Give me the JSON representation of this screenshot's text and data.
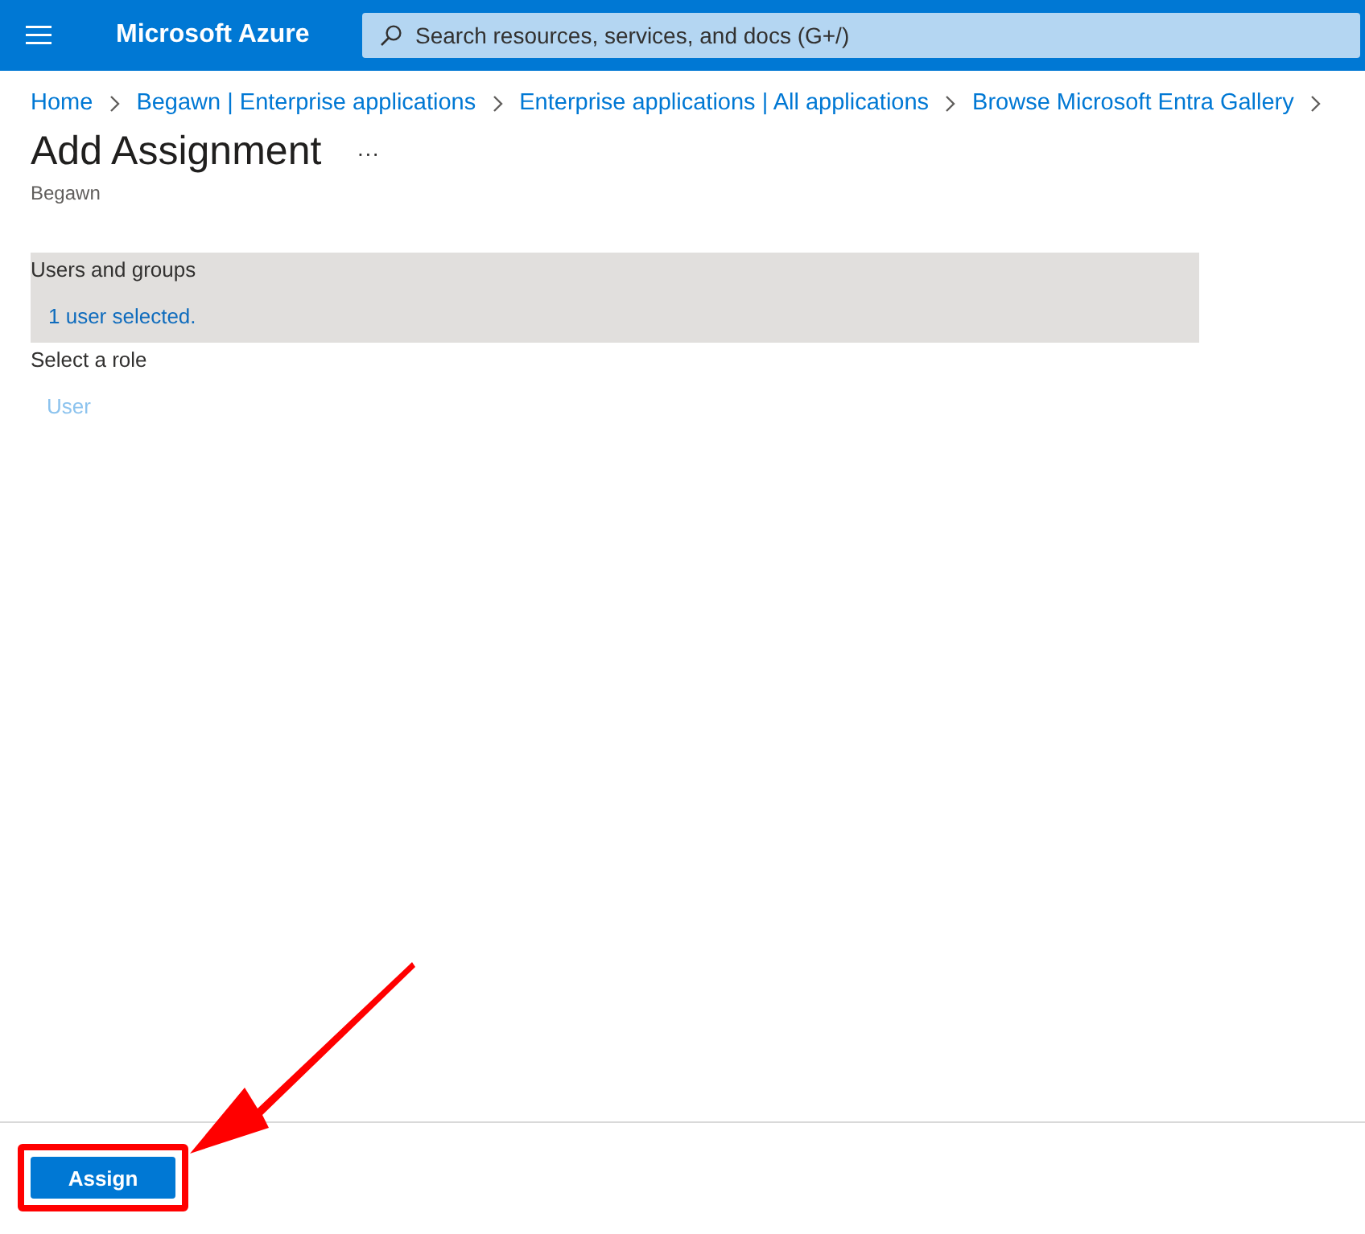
{
  "header": {
    "brand": "Microsoft Azure",
    "search": {
      "placeholder": "Search resources, services, and docs (G+/)"
    }
  },
  "breadcrumb": [
    "Home",
    "Begawn | Enterprise applications",
    "Enterprise applications | All applications",
    "Browse Microsoft Entra Gallery"
  ],
  "page": {
    "title": "Add Assignment",
    "more": "···",
    "subtitle": "Begawn"
  },
  "sections": [
    {
      "kind": "selection",
      "label": "Users and groups",
      "value": "1 user selected."
    },
    {
      "kind": "role",
      "label": "Select a role",
      "value": "User"
    }
  ],
  "footer": {
    "button": {
      "label": "Assign",
      "highlighted": true
    }
  }
}
